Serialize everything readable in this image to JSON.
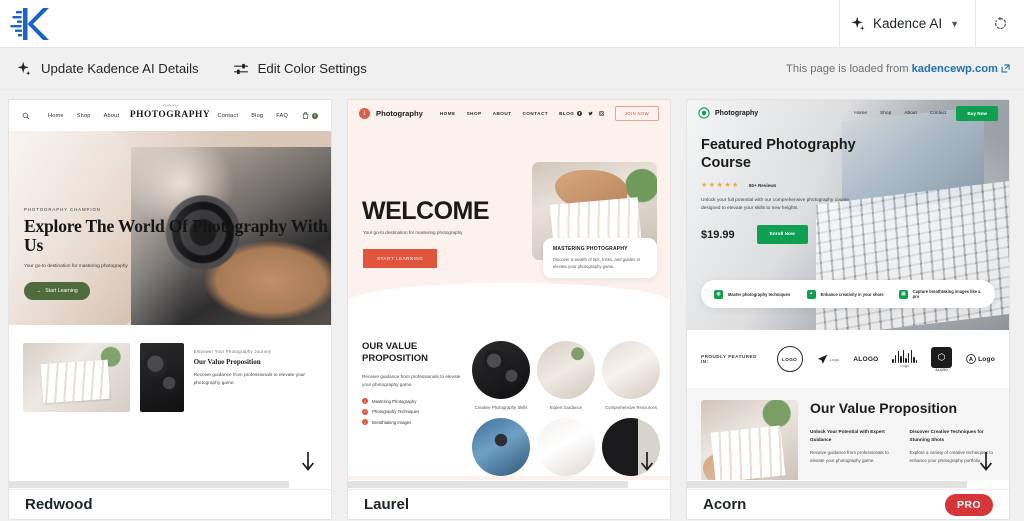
{
  "topbar": {
    "logo_name": "kadence-logo",
    "ai_menu_label": "Kadence AI",
    "refresh_title": "Refresh"
  },
  "subbar": {
    "update_details_label": "Update Kadence AI Details",
    "edit_colors_label": "Edit Color Settings",
    "loaded_from_prefix": "This page is loaded from",
    "loaded_from_link": "kadencewp.com"
  },
  "templates": [
    {
      "name": "Redwood",
      "pro": false,
      "nav": {
        "left_links": [
          "Home",
          "Shop",
          "About"
        ],
        "right_links": [
          "Contact",
          "Blog",
          "FAQ"
        ],
        "brand": "PHOTOGRAPHY",
        "squiggle": "〜〜〜",
        "cart_count": "0"
      },
      "hero": {
        "eyebrow": "PHOTOGRAPHY CHAMPION",
        "heading": "Explore The World Of Photography With Us",
        "sub": "Your go-to destination for mastering photography",
        "button": "Start Learning",
        "button_color": "#4e6b3c"
      },
      "value": {
        "kicker": "Empower Your Photography Journey",
        "title": "Our Value Proposition",
        "body": "Receive guidance from professionals to elevate your photography game."
      }
    },
    {
      "name": "Laurel",
      "pro": false,
      "nav": {
        "brand": "Photography",
        "badge_letter": "i",
        "links": [
          "HOME",
          "SHOP",
          "ABOUT",
          "CONTACT",
          "BLOG"
        ],
        "cta": "JOIN NOW",
        "accent": "#e0553c"
      },
      "hero": {
        "heading": "WELCOME",
        "sub": "Your go-to destination for mastering photography",
        "button": "START LEARNING"
      },
      "floating_card": {
        "title": "MASTERING PHOTOGRAPHY",
        "body": "Discover a wealth of tips, tricks, and guides to elevate your photography game."
      },
      "value": {
        "title": "OUR VALUE PROPOSITION",
        "body": "Receive guidance from professionals to elevate your photography game.",
        "bullets": [
          "Mastering Photography",
          "Photography Techniques",
          "Breathtaking Images"
        ],
        "captions": [
          "Creative Photography Skills",
          "Expert Guidance",
          "Comprehensive Resources"
        ]
      }
    },
    {
      "name": "Acorn",
      "pro": true,
      "pro_label": "PRO",
      "nav": {
        "brand": "Photography",
        "links": [
          "Home",
          "Shop",
          "About",
          "Contact"
        ],
        "cta": "Buy Now",
        "accent": "#0e9f51"
      },
      "hero": {
        "heading": "Featured Photography Course",
        "stars": "★★★★★",
        "reviews": "80+ Reviews",
        "body": "Unlock your full potential with our comprehensive photography course designed to elevate your skills to new heights.",
        "price": "$19.99",
        "button": "Enroll Now"
      },
      "features": [
        "Master photography techniques",
        "Enhance creativity in your shots",
        "Capture breathtaking images like a pro"
      ],
      "featured_in": {
        "label": "PROUDLY FEATURED IN:",
        "logos": [
          "LOGO",
          "Logo",
          "ALOGO",
          "Logo",
          "ALOGO",
          "Logo"
        ]
      },
      "value": {
        "title": "Our Value Proposition",
        "columns": [
          {
            "title": "Unlock Your Potential with Expert Guidance",
            "body": "Receive guidance from professionals to elevate your photography game."
          },
          {
            "title": "Discover Creative Techniques for Stunning Shots",
            "body": "Explore a variety of creative techniques to enhance your photography portfolio."
          }
        ]
      }
    }
  ]
}
